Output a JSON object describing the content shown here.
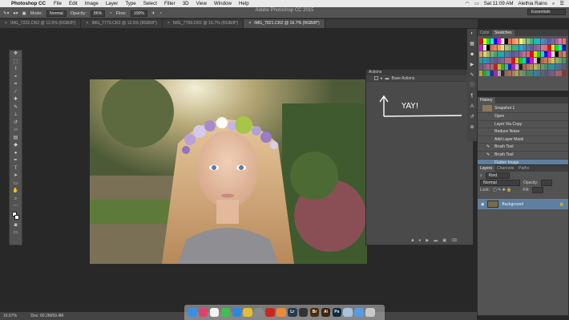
{
  "menubar": {
    "app_name": "Photoshop CC",
    "menus": [
      "File",
      "Edit",
      "Image",
      "Layer",
      "Type",
      "Select",
      "Filter",
      "3D",
      "View",
      "Window",
      "Help"
    ],
    "clock": "Sat 11:09 AM",
    "user": "Alethia Rains"
  },
  "window": {
    "title": "Adobe Photoshop CC 2015"
  },
  "options": {
    "mode_label": "Mode:",
    "mode_value": "Normal",
    "opacity_label": "Opacity:",
    "opacity_value": "86%",
    "flow_label": "Flow:",
    "flow_value": "100%",
    "workspace": "Essentials"
  },
  "tabs": [
    {
      "label": "IMG_7222.CR2 @ 12.5% (RGB/8*)",
      "active": false
    },
    {
      "label": "IMG_7773.CR2 @ 12.5% (RGB/8*)",
      "active": false
    },
    {
      "label": "IMG_7799.CR2 @ 16.7% (RGB/8*)",
      "active": false
    },
    {
      "label": "IMG_7821.CR2 @ 16.7% (RGB/8*)",
      "active": true
    }
  ],
  "actions_panel": {
    "title": "Actions",
    "set_name": "Base Actions",
    "annotation": "YAY!"
  },
  "color_panel": {
    "tabs": [
      "Color",
      "Swatches"
    ],
    "active": "Swatches"
  },
  "history_panel": {
    "title": "History",
    "snapshot": "Snapshot 1",
    "steps": [
      "Open",
      "Layer Via Copy",
      "Reduce Noise",
      "Add Layer Mask",
      "Brush Tool",
      "Brush Tool",
      "Flatten Image"
    ],
    "selected": "Flatten Image"
  },
  "layers_panel": {
    "tabs": [
      "Layers",
      "Channels",
      "Paths"
    ],
    "kind_label": "Kind",
    "blend_value": "Normal",
    "opacity_label": "Opacity:",
    "lock_label": "Lock:",
    "fill_label": "Fill:",
    "layer_name": "Background"
  },
  "status": {
    "zoom": "16.67%",
    "doc": "Doc: 60.2M/59.4M"
  },
  "dock_apps": [
    {
      "name": "finder",
      "color": "#3b8fe0"
    },
    {
      "name": "itunes",
      "color": "#e0426c"
    },
    {
      "name": "calendar",
      "color": "#f4f4f4"
    },
    {
      "name": "facetime",
      "color": "#3ec04b"
    },
    {
      "name": "safari",
      "color": "#2e86d6"
    },
    {
      "name": "chrome",
      "color": "#e0c033"
    },
    {
      "name": "settings",
      "color": "#8a8a8a"
    },
    {
      "name": "acrobat",
      "color": "#c8261f"
    },
    {
      "name": "photos",
      "color": "#ec8a3c"
    },
    {
      "name": "lightroom",
      "color": "#2a3a4c",
      "text": "Lr"
    },
    {
      "name": "camera",
      "color": "#333333"
    },
    {
      "name": "bridge",
      "color": "#4e2a0e",
      "text": "Br"
    },
    {
      "name": "illustrator",
      "color": "#3b2410",
      "text": "Ai"
    },
    {
      "name": "photoshop",
      "color": "#0b2a45",
      "text": "Ps"
    },
    {
      "name": "preview",
      "color": "#a8c4dc"
    },
    {
      "name": "downloads",
      "color": "#5a9ae0"
    },
    {
      "name": "trash",
      "color": "#c9c9c9"
    }
  ],
  "colors": {
    "ui_dark": "#282828",
    "panel": "#535353",
    "selection": "#5e7fa0"
  }
}
